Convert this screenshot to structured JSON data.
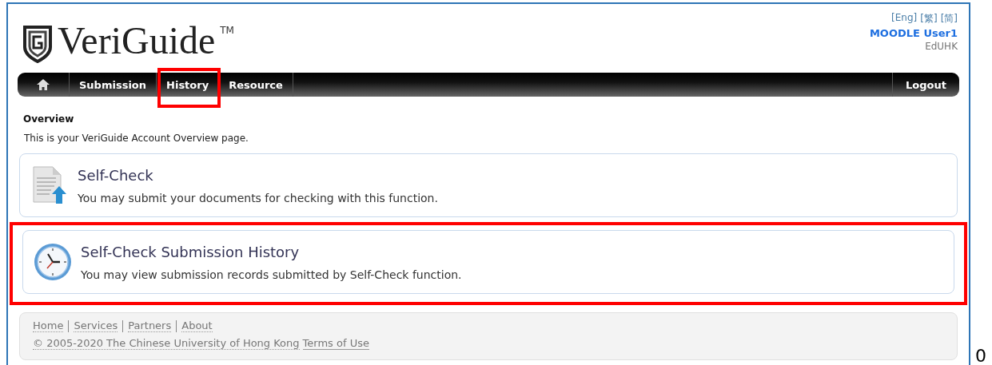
{
  "header": {
    "logo": "VeriGuide",
    "trademark": "TM",
    "languages": [
      "[Eng]",
      "[繁]",
      "[简]"
    ],
    "user": "MOODLE User1",
    "institution": "EdUHK"
  },
  "nav": {
    "items": [
      {
        "label": "Submission",
        "highlighted": false
      },
      {
        "label": "History",
        "highlighted": true
      },
      {
        "label": "Resource",
        "highlighted": false
      }
    ],
    "logout": "Logout"
  },
  "overview": {
    "heading": "Overview",
    "intro": "This is your VeriGuide Account Overview page."
  },
  "cards": [
    {
      "kind": "document",
      "title": "Self-Check",
      "description": "You may submit your documents for checking with this function.",
      "highlighted": false
    },
    {
      "kind": "clock",
      "title": "Self-Check Submission History",
      "description": "You may view submission records submitted by Self-Check function.",
      "highlighted": true
    }
  ],
  "footer": {
    "links": [
      "Home",
      "Services",
      "Partners",
      "About"
    ],
    "copyright": "© 2005-2020 The Chinese University of Hong Kong",
    "terms": "Terms of Use"
  },
  "page_marker": "0"
}
